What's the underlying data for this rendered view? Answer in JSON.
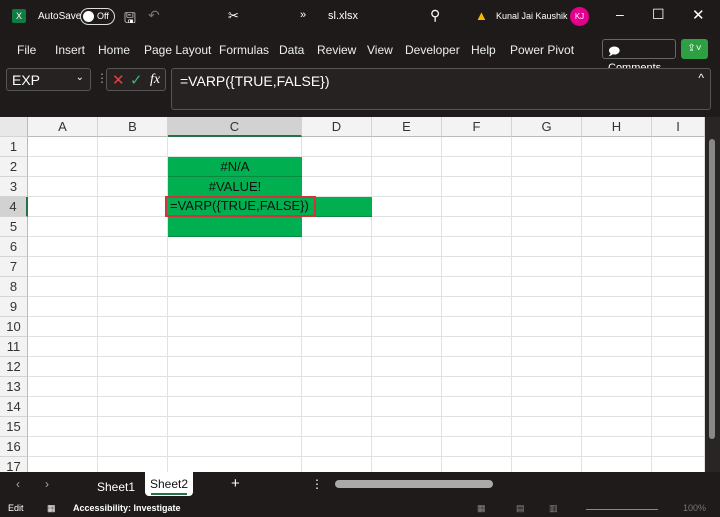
{
  "titlebar": {
    "autosave": "AutoSave",
    "toggle": "Off",
    "filename": "sl.xlsx",
    "user": "Kunal Jai Kaushik",
    "initials": "KJ"
  },
  "menu": [
    "File",
    "Insert",
    "Home",
    "Page Layout",
    "Formulas",
    "Data",
    "Review",
    "View",
    "Developer",
    "Help",
    "Power Pivot"
  ],
  "comments": "Comments",
  "formula_bar": {
    "name_box": "EXP",
    "formula": "=VARP({TRUE,FALSE})",
    "fx": "fx"
  },
  "columns": [
    "A",
    "B",
    "C",
    "D",
    "E",
    "F",
    "G",
    "H",
    "I"
  ],
  "rows": [
    "1",
    "2",
    "3",
    "4",
    "5",
    "6",
    "7",
    "8",
    "9",
    "10",
    "11",
    "12",
    "13",
    "14",
    "15",
    "16",
    "17"
  ],
  "cells": {
    "C2": "#N/A",
    "C3": "#VALUE!",
    "C4": "=VARP({TRUE,FALSE})"
  },
  "sheets": [
    "Sheet1",
    "Sheet2"
  ],
  "active_sheet": "Sheet2",
  "status": {
    "mode": "Edit",
    "accessibility": "Accessibility: Investigate",
    "zoom": "100%"
  },
  "colors": {
    "fill": "#00b050",
    "edit_border": "#d13438",
    "avatar": "#e3008c"
  }
}
